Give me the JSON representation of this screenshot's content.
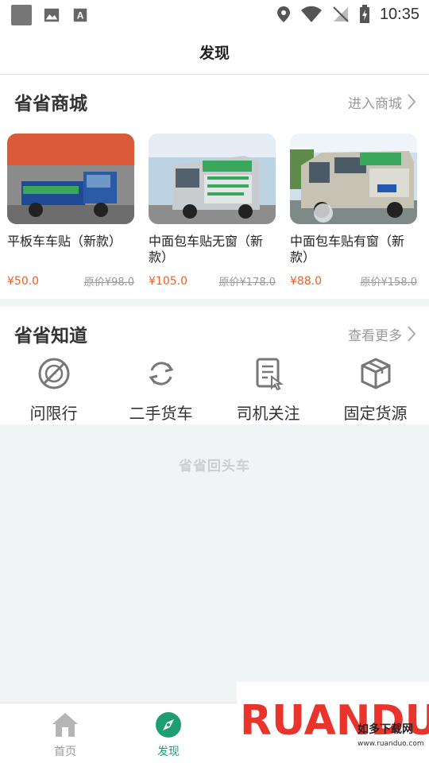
{
  "status_bar": {
    "time": "10:35"
  },
  "header": {
    "title": "发现"
  },
  "mall": {
    "title": "省省商城",
    "more_label": "进入商城",
    "products": [
      {
        "name": "平板车车贴（新款）",
        "price": "¥50.0",
        "original_price": "原价¥98.0"
      },
      {
        "name": "中面包车贴无窗（新款）",
        "price": "¥105.0",
        "original_price": "原价¥178.0"
      },
      {
        "name": "中面包车贴有窗（新款）",
        "price": "¥88.0",
        "original_price": "原价¥158.0"
      }
    ]
  },
  "knowledge": {
    "title": "省省知道",
    "more_label": "查看更多",
    "tools": [
      {
        "label": "问限行",
        "icon": "no-entry-icon"
      },
      {
        "label": "二手货车",
        "icon": "refresh-icon"
      },
      {
        "label": "司机关注",
        "icon": "document-touch-icon"
      },
      {
        "label": "固定货源",
        "icon": "box-icon"
      }
    ]
  },
  "content": {
    "placeholder_brand": "省省回头车"
  },
  "tabbar": {
    "tabs": [
      {
        "label": "首页",
        "icon": "home-icon"
      },
      {
        "label": "发现",
        "icon": "compass-icon"
      }
    ]
  },
  "logo": {
    "text_main": "RUANDUO",
    "text_cn": "如多下载网",
    "url": "www.ruanduo.com"
  },
  "colors": {
    "accent": "#1f9e74",
    "price": "#e8612a",
    "background": "#f0f4f4"
  }
}
